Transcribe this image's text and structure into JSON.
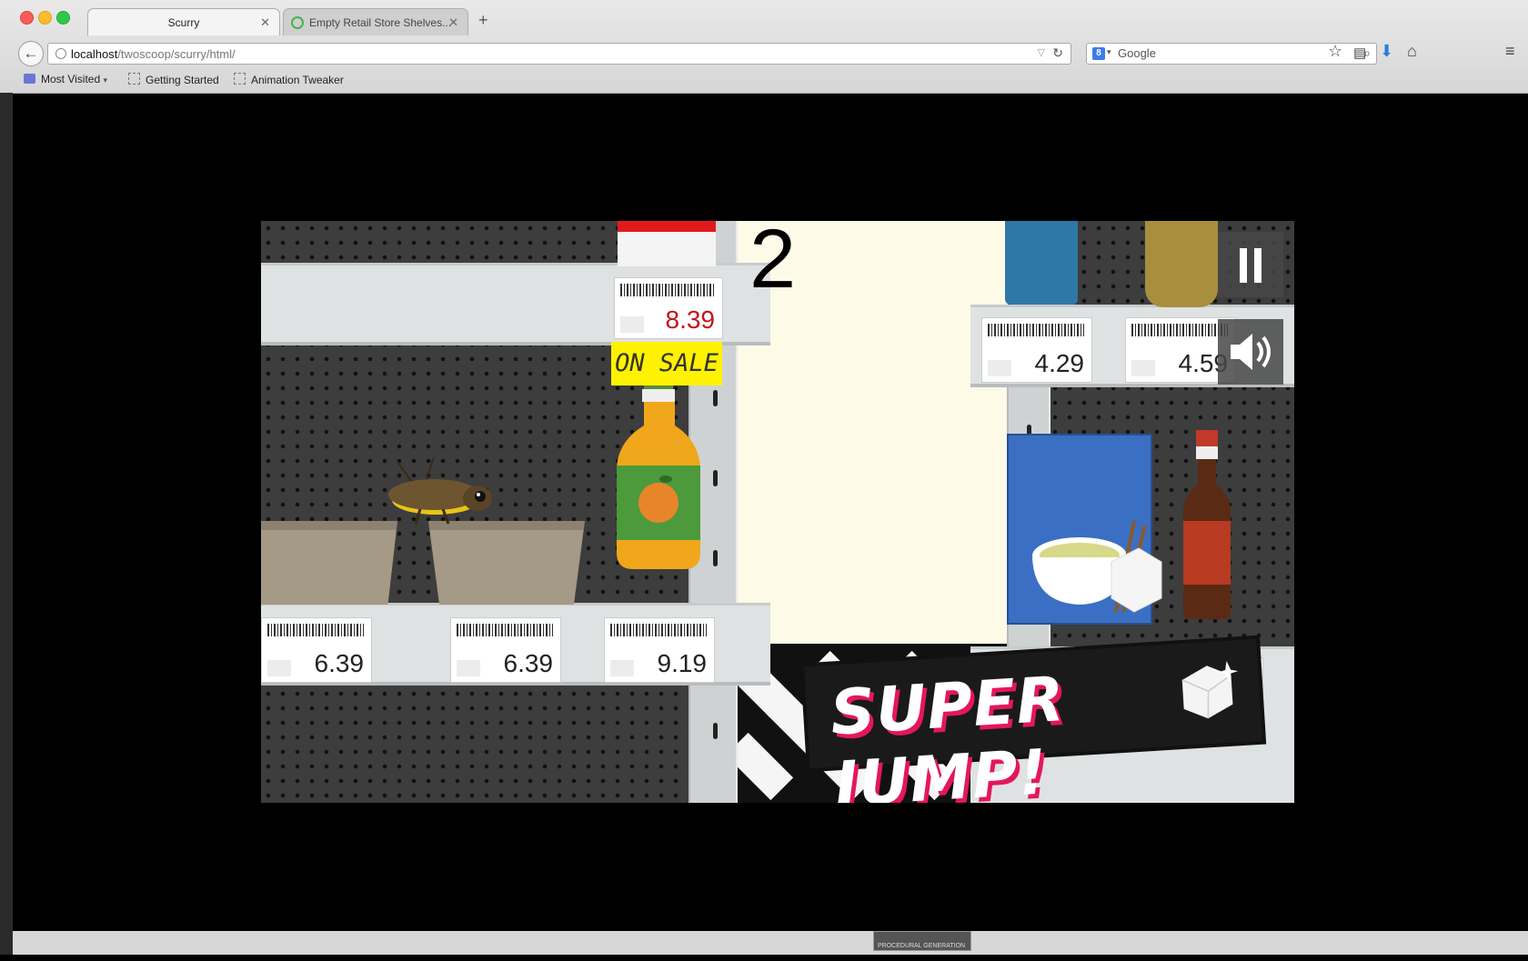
{
  "browser": {
    "tabs": [
      {
        "title": "Scurry",
        "active": true
      },
      {
        "title": "Empty Retail Store Shelves...",
        "active": false
      }
    ],
    "new_tab_label": "+",
    "url": {
      "host": "localhost",
      "path": "/twoscoop/scurry/html/"
    },
    "search": {
      "placeholder": "Google",
      "engine_icon": "google-icon"
    },
    "toolbar_icons": [
      "star-icon",
      "reading-list-icon",
      "download-icon",
      "home-icon",
      "menu-icon"
    ],
    "bookmarks": [
      {
        "label": "Most Visited",
        "icon": "folder-icon"
      },
      {
        "label": "Getting Started",
        "icon": "page-icon"
      },
      {
        "label": "Animation Tweaker",
        "icon": "page-icon"
      }
    ]
  },
  "game": {
    "score": "2",
    "price_tags": [
      {
        "price": "8.39",
        "sale": true
      },
      {
        "price": "4.29",
        "sale": false
      },
      {
        "price": "4.59",
        "sale": false
      },
      {
        "price": "6.39",
        "sale": false
      },
      {
        "price": "6.39",
        "sale": false
      },
      {
        "price": "9.19",
        "sale": false
      }
    ],
    "on_sale_label": "ON SALE",
    "banner_text": "SUPER JUMP!",
    "controls": {
      "pause_icon": "pause-icon",
      "sound_icon": "speaker-icon"
    },
    "colors": {
      "sale_price": "#c0161a",
      "sale_badge": "#fff200",
      "banner_shadow": "#e4175a",
      "back_wall": "#fdfbe7"
    }
  },
  "dock": {
    "thumbnail_label": "PROCEDURAL GENERATION"
  }
}
